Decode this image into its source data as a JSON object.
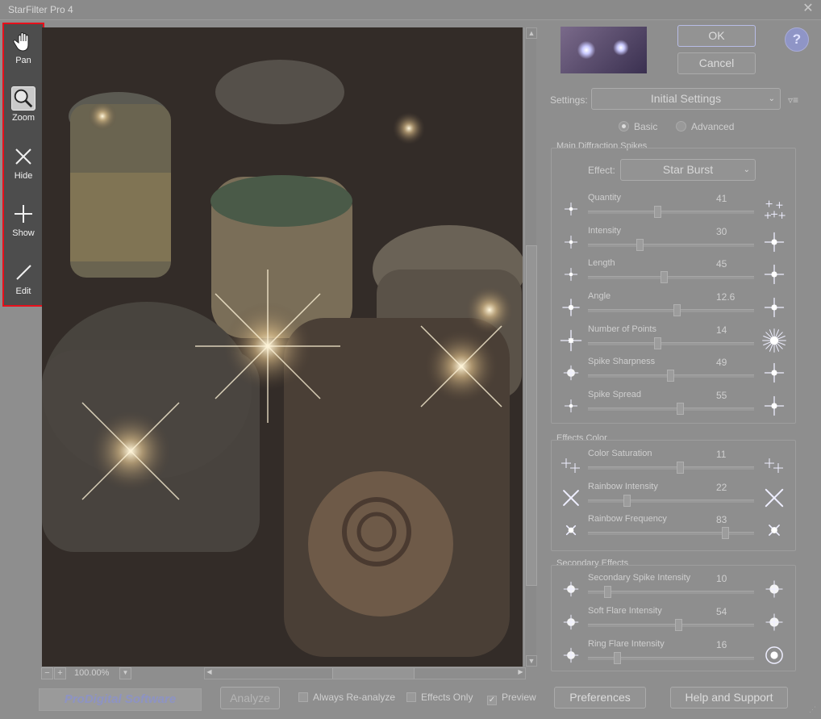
{
  "window": {
    "title": "StarFilter Pro 4"
  },
  "tools": [
    {
      "label": "Pan",
      "icon": "hand-icon",
      "active": false
    },
    {
      "label": "Zoom",
      "icon": "magnifier-icon",
      "active": true
    },
    {
      "label": "Hide",
      "icon": "x-icon",
      "active": false
    },
    {
      "label": "Show",
      "icon": "plus-icon",
      "active": false
    },
    {
      "label": "Edit",
      "icon": "pencil-icon",
      "active": false
    }
  ],
  "zoom": {
    "level": "100.00%"
  },
  "buttons": {
    "ok": "OK",
    "cancel": "Cancel",
    "analyze": "Analyze",
    "preferences": "Preferences",
    "help_support": "Help and Support",
    "help": "?"
  },
  "branding": {
    "logo": "ProDigital Software"
  },
  "checkboxes": {
    "always_reanalyze": {
      "label": "Always Re-analyze",
      "checked": false
    },
    "effects_only": {
      "label": "Effects Only",
      "checked": false
    },
    "preview": {
      "label": "Preview",
      "checked": true
    }
  },
  "settings": {
    "label": "Settings:",
    "value": "Initial Settings"
  },
  "mode": {
    "basic": "Basic",
    "advanced": "Advanced",
    "selected": "basic"
  },
  "main_group": {
    "title": "Main Diffraction Spikes",
    "effect_label": "Effect:",
    "effect_value": "Star Burst",
    "sliders": [
      {
        "label": "Quantity",
        "value": "41",
        "fraction": 0.41
      },
      {
        "label": "Intensity",
        "value": "30",
        "fraction": 0.3
      },
      {
        "label": "Length",
        "value": "45",
        "fraction": 0.45
      },
      {
        "label": "Angle",
        "value": "12.6",
        "fraction": 0.53
      },
      {
        "label": "Number of Points",
        "value": "14",
        "fraction": 0.41
      },
      {
        "label": "Spike Sharpness",
        "value": "49",
        "fraction": 0.49
      },
      {
        "label": "Spike Spread",
        "value": "55",
        "fraction": 0.55
      }
    ]
  },
  "color_group": {
    "title": "Effects Color",
    "sliders": [
      {
        "label": "Color Saturation",
        "value": "11",
        "fraction": 0.55
      },
      {
        "label": "Rainbow Intensity",
        "value": "22",
        "fraction": 0.22
      },
      {
        "label": "Rainbow Frequency",
        "value": "83",
        "fraction": 0.83
      }
    ]
  },
  "secondary_group": {
    "title": "Secondary Effects",
    "sliders": [
      {
        "label": "Secondary Spike Intensity",
        "value": "10",
        "fraction": 0.1
      },
      {
        "label": "Soft Flare Intensity",
        "value": "54",
        "fraction": 0.54
      },
      {
        "label": "Ring Flare Intensity",
        "value": "16",
        "fraction": 0.16
      }
    ]
  }
}
